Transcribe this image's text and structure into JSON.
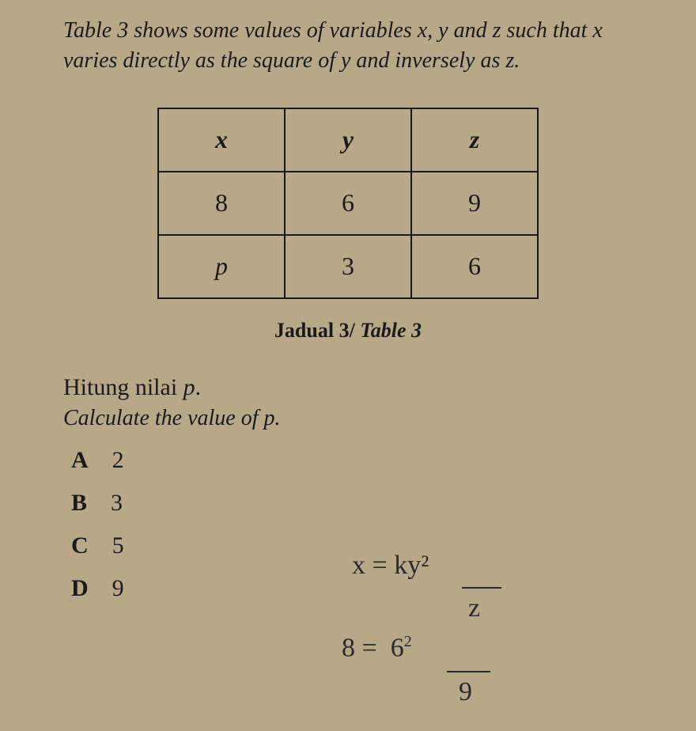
{
  "intro": "Table 3 shows some values of variables x, y and z such that x varies directly as the square of y and inversely as z.",
  "table": {
    "headers": [
      "x",
      "y",
      "z"
    ],
    "rows": [
      [
        "8",
        "6",
        "9"
      ],
      [
        "p",
        "3",
        "6"
      ]
    ]
  },
  "caption_ms": "Jadual 3/",
  "caption_en": "Table 3",
  "question_ms_pre": "Hitung nilai ",
  "question_ms_var": "p",
  "question_ms_post": ".",
  "question_en": "Calculate the value of p.",
  "options": [
    {
      "letter": "A",
      "value": "2"
    },
    {
      "letter": "B",
      "value": "3"
    },
    {
      "letter": "C",
      "value": "5"
    },
    {
      "letter": "D",
      "value": "9"
    }
  ],
  "handwritten": {
    "eq1_lhs": "x =",
    "eq1_num": "ky²",
    "eq1_den": "z",
    "eq2_lhs": "8 =",
    "eq2_num": "6",
    "eq2_sup": "2",
    "eq2_den": "9"
  }
}
